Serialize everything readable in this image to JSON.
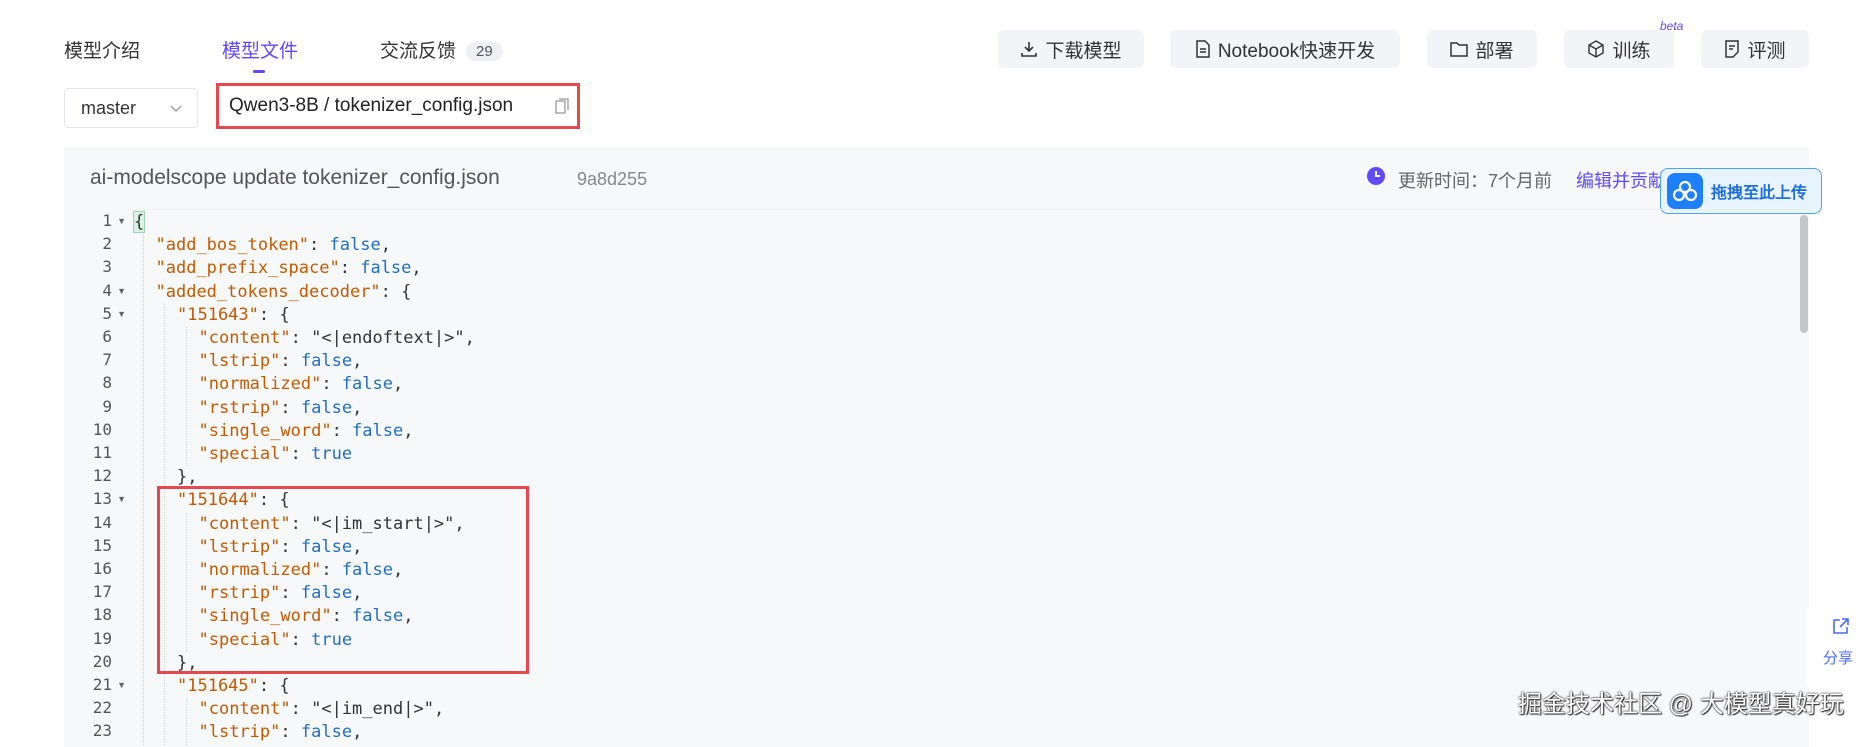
{
  "tabs": [
    {
      "label": "模型介绍",
      "active": false
    },
    {
      "label": "模型文件",
      "active": true
    },
    {
      "label": "交流反馈",
      "active": false,
      "badge": "29"
    }
  ],
  "toolbar": {
    "download": "下载模型",
    "notebook": "Notebook快速开发",
    "deploy": "部署",
    "train": "训练",
    "train_badge": "beta",
    "evaluate": "评测"
  },
  "branch": {
    "value": "master"
  },
  "file_path": "Qwen3-8B / tokenizer_config.json",
  "commit": {
    "message": "ai-modelscope update tokenizer_config.json",
    "hash": "9a8d255",
    "updated": "更新时间：7个月前",
    "edit_link": "编辑并贡献"
  },
  "drag_upload": "拖拽至此上传",
  "code_lines": [
    {
      "n": 1,
      "fold": true,
      "indent": 0,
      "text": "{"
    },
    {
      "n": 2,
      "fold": false,
      "indent": 1,
      "key": "\"add_bos_token\"",
      "val": "false",
      "vt": "bool",
      "tail": ","
    },
    {
      "n": 3,
      "fold": false,
      "indent": 1,
      "key": "\"add_prefix_space\"",
      "val": "false",
      "vt": "bool",
      "tail": ","
    },
    {
      "n": 4,
      "fold": true,
      "indent": 1,
      "key": "\"added_tokens_decoder\"",
      "val": "{",
      "vt": "punc",
      "tail": ""
    },
    {
      "n": 5,
      "fold": true,
      "indent": 2,
      "key": "\"151643\"",
      "val": "{",
      "vt": "punc",
      "tail": ""
    },
    {
      "n": 6,
      "fold": false,
      "indent": 3,
      "key": "\"content\"",
      "val": "\"<|endoftext|>\"",
      "vt": "str",
      "tail": ","
    },
    {
      "n": 7,
      "fold": false,
      "indent": 3,
      "key": "\"lstrip\"",
      "val": "false",
      "vt": "bool",
      "tail": ","
    },
    {
      "n": 8,
      "fold": false,
      "indent": 3,
      "key": "\"normalized\"",
      "val": "false",
      "vt": "bool",
      "tail": ","
    },
    {
      "n": 9,
      "fold": false,
      "indent": 3,
      "key": "\"rstrip\"",
      "val": "false",
      "vt": "bool",
      "tail": ","
    },
    {
      "n": 10,
      "fold": false,
      "indent": 3,
      "key": "\"single_word\"",
      "val": "false",
      "vt": "bool",
      "tail": ","
    },
    {
      "n": 11,
      "fold": false,
      "indent": 3,
      "key": "\"special\"",
      "val": "true",
      "vt": "bool",
      "tail": ""
    },
    {
      "n": 12,
      "fold": false,
      "indent": 2,
      "text": "},"
    },
    {
      "n": 13,
      "fold": true,
      "indent": 2,
      "key": "\"151644\"",
      "val": "{",
      "vt": "punc",
      "tail": ""
    },
    {
      "n": 14,
      "fold": false,
      "indent": 3,
      "key": "\"content\"",
      "val": "\"<|im_start|>\"",
      "vt": "str",
      "tail": ","
    },
    {
      "n": 15,
      "fold": false,
      "indent": 3,
      "key": "\"lstrip\"",
      "val": "false",
      "vt": "bool",
      "tail": ","
    },
    {
      "n": 16,
      "fold": false,
      "indent": 3,
      "key": "\"normalized\"",
      "val": "false",
      "vt": "bool",
      "tail": ","
    },
    {
      "n": 17,
      "fold": false,
      "indent": 3,
      "key": "\"rstrip\"",
      "val": "false",
      "vt": "bool",
      "tail": ","
    },
    {
      "n": 18,
      "fold": false,
      "indent": 3,
      "key": "\"single_word\"",
      "val": "false",
      "vt": "bool",
      "tail": ","
    },
    {
      "n": 19,
      "fold": false,
      "indent": 3,
      "key": "\"special\"",
      "val": "true",
      "vt": "bool",
      "tail": ""
    },
    {
      "n": 20,
      "fold": false,
      "indent": 2,
      "text": "},"
    },
    {
      "n": 21,
      "fold": true,
      "indent": 2,
      "key": "\"151645\"",
      "val": "{",
      "vt": "punc",
      "tail": ""
    },
    {
      "n": 22,
      "fold": false,
      "indent": 3,
      "key": "\"content\"",
      "val": "\"<|im_end|>\"",
      "vt": "str",
      "tail": ","
    },
    {
      "n": 23,
      "fold": false,
      "indent": 3,
      "key": "\"lstrip\"",
      "val": "false",
      "vt": "bool",
      "tail": ","
    }
  ],
  "share": {
    "label": "分享"
  },
  "watermark": "掘金技术社区 @ 大模型真好玩",
  "colors": {
    "accent": "#624aff",
    "highlight_border": "#e5484d",
    "json_key": "#c25b00",
    "json_bool": "#1f6fbf"
  }
}
